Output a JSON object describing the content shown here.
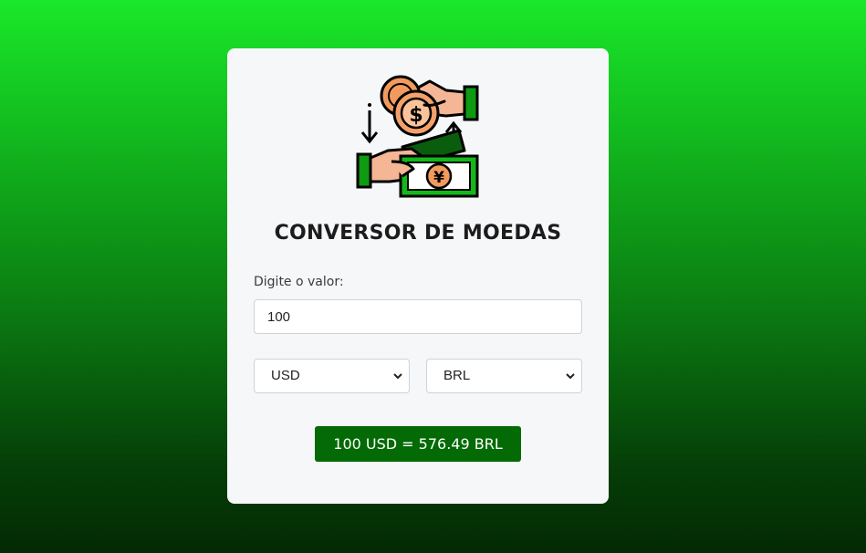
{
  "app": {
    "title": "CONVERSOR DE MOEDAS",
    "illustration": "currency-exchange-hands-icon"
  },
  "form": {
    "amount_label": "Digite o valor:",
    "amount_value": "100",
    "from_currency": "USD",
    "to_currency": "BRL"
  },
  "result": {
    "text": "100 USD = 576.49 BRL"
  },
  "colors": {
    "accent": "#046a05",
    "background_top": "#1ae82a",
    "background_bottom": "#032a04",
    "card": "#f6f7f9"
  }
}
